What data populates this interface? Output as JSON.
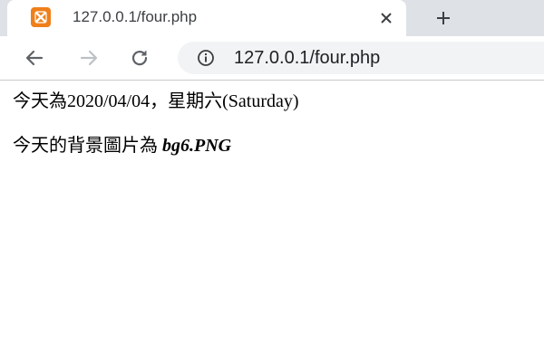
{
  "tab": {
    "title": "127.0.0.1/four.php",
    "favicon": "xampp-icon",
    "close_icon": "close-icon"
  },
  "new_tab_icon": "plus-icon",
  "toolbar": {
    "back_icon": "back-arrow-icon",
    "forward_icon": "forward-arrow-icon",
    "reload_icon": "reload-icon",
    "info_icon": "info-icon",
    "url": "127.0.0.1/four.php"
  },
  "page": {
    "line1": "今天為2020/04/04，星期六(Saturday)",
    "line2_prefix": "今天的背景圖片為 ",
    "line2_filename": "bg6.PNG"
  },
  "colors": {
    "tabstrip": "#dee1e6",
    "omnibox": "#f1f3f4",
    "favicon": "#ef7f1a",
    "icon": "#5f6368",
    "icon_disabled": "#bdc1c6"
  }
}
